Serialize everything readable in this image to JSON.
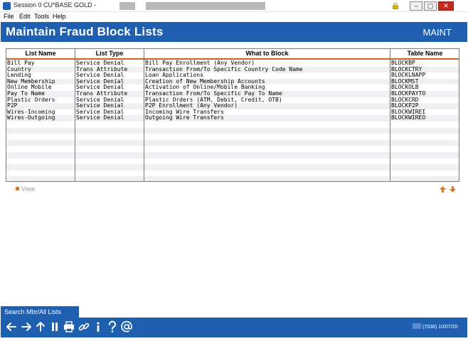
{
  "window": {
    "title": "Session 0 CU*BASE GOLD -",
    "minimize": "–",
    "restore": "▢",
    "close": "✕"
  },
  "menu": {
    "file": "File",
    "edit": "Edit",
    "tools": "Tools",
    "help": "Help"
  },
  "header": {
    "title": "Maintain Fraud Block Lists",
    "mode": "MAINT"
  },
  "table": {
    "columns": [
      "List Name",
      "List Type",
      "What to Block",
      "Table Name"
    ],
    "rows": [
      [
        "Bill Pay",
        "Service Denial",
        "Bill Pay Enrollment (Any Vendor)",
        "BLOCKBP"
      ],
      [
        "Country",
        "Trans Attribute",
        "Transaction From/To Specific Country Code Name",
        "BLOCKCTRY"
      ],
      [
        "Lending",
        "Service Denial",
        "Loan Applications",
        "BLOCKLNAPP"
      ],
      [
        "New Membership",
        "Service Denial",
        "Creation of New Membership Accounts",
        "BLOCKMST"
      ],
      [
        "Online Mobile",
        "Service Denial",
        "Activation of Online/Mobile Banking",
        "BLOCKOLB"
      ],
      [
        "Pay To Name",
        "Trans Attribute",
        "Transaction From/To Specific Pay To Name",
        "BLOCKPAYTO"
      ],
      [
        "Plastic Orders",
        "Service Denial",
        "Plastic Orders (ATM, Debit, Credit, OTB)",
        "BLOCKCRD"
      ],
      [
        "P2P",
        "Service Denial",
        "P2P Enrollment (Any Vendor)",
        "BLOCKP2P"
      ],
      [
        "Wires-Incoming",
        "Service Denial",
        "Incoming Wire Transfers",
        "BLOCKWIREI"
      ],
      [
        "Wires-Outgoing",
        "Service Denial",
        "Outgoing Wire Transfers",
        "BLOCKWIREO"
      ]
    ]
  },
  "actions": {
    "view": "View"
  },
  "footer": {
    "search_tab": "Search Mbr/All Lists",
    "status": "(7038) 10/07/20"
  },
  "colors": {
    "brand_blue": "#1e5fb0",
    "accent_orange": "#d07a2a"
  },
  "icons": [
    "back-icon",
    "forward-icon",
    "up-icon",
    "pause-icon",
    "print-icon",
    "link-icon",
    "info-icon",
    "help-icon",
    "email-icon"
  ]
}
